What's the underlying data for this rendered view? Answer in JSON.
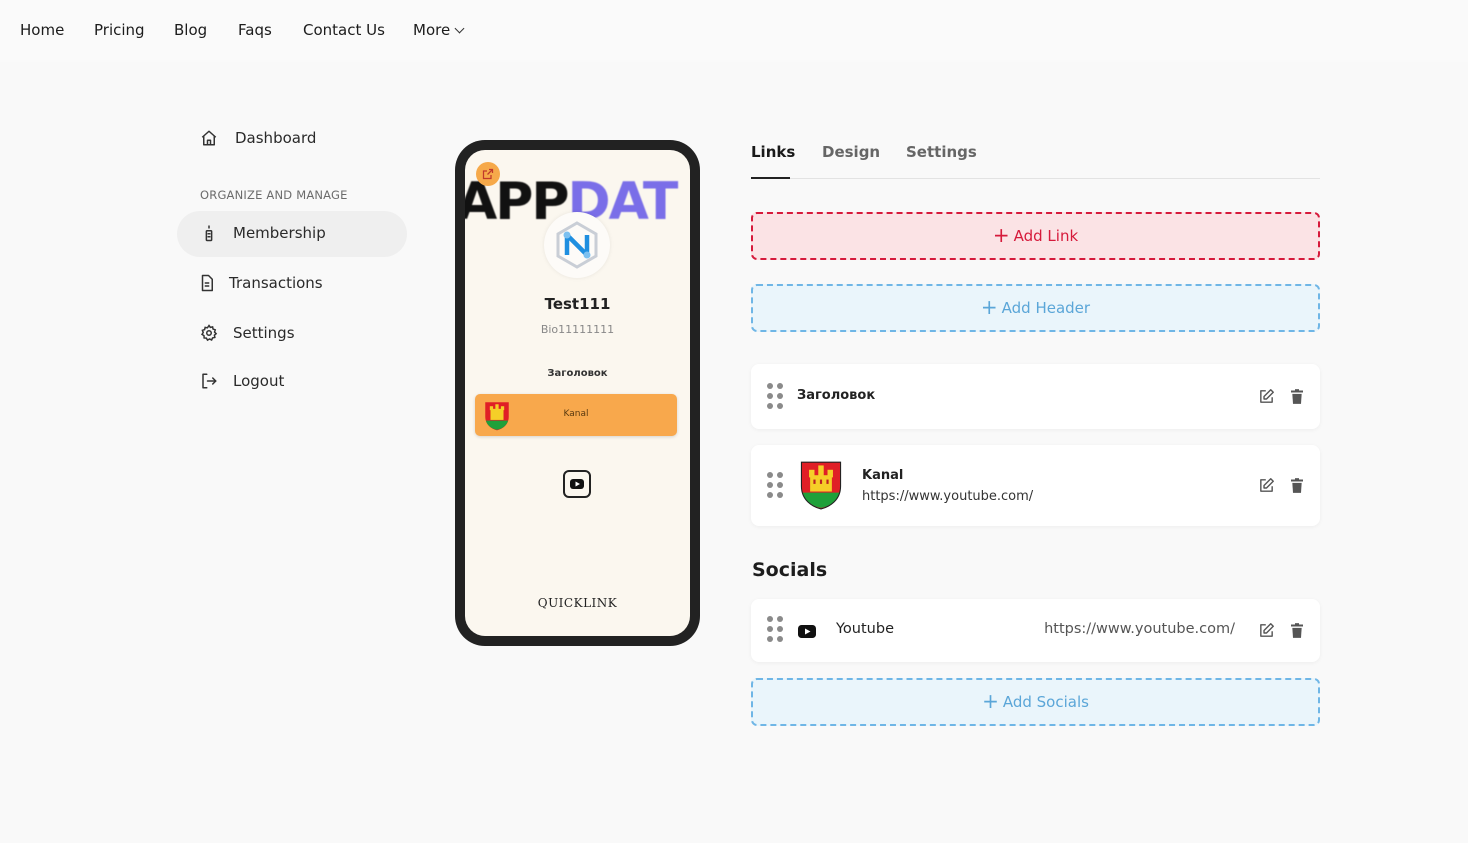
{
  "nav": {
    "items": [
      "Home",
      "Pricing",
      "Blog",
      "Faqs",
      "Contact Us"
    ],
    "more": "More"
  },
  "sidebar": {
    "dashboard": "Dashboard",
    "section": "ORGANIZE AND MANAGE",
    "membership": "Membership",
    "transactions": "Transactions",
    "settings": "Settings",
    "logout": "Logout"
  },
  "preview": {
    "banner_dark": "APP",
    "banner_purple": "DAT",
    "name": "Test111",
    "bio": "Bio11111111",
    "header": "Заголовок",
    "link_label": "Kanal",
    "brand": "QUICKLINK"
  },
  "tabs": [
    "Links",
    "Design",
    "Settings"
  ],
  "actions": {
    "add_link": "Add Link",
    "add_header": "Add Header",
    "add_socials": "Add Socials"
  },
  "links": [
    {
      "type": "header",
      "title": "Заголовок"
    },
    {
      "type": "link",
      "title": "Kanal",
      "url": "https://www.youtube.com/"
    }
  ],
  "socials": {
    "title": "Socials",
    "items": [
      {
        "name": "Youtube",
        "url": "https://www.youtube.com/",
        "icon": "youtube-icon"
      }
    ]
  },
  "colors": {
    "accent_red": "#d61a3b",
    "accent_blue": "#5ba6d8",
    "link_orange": "#f8a84c"
  }
}
